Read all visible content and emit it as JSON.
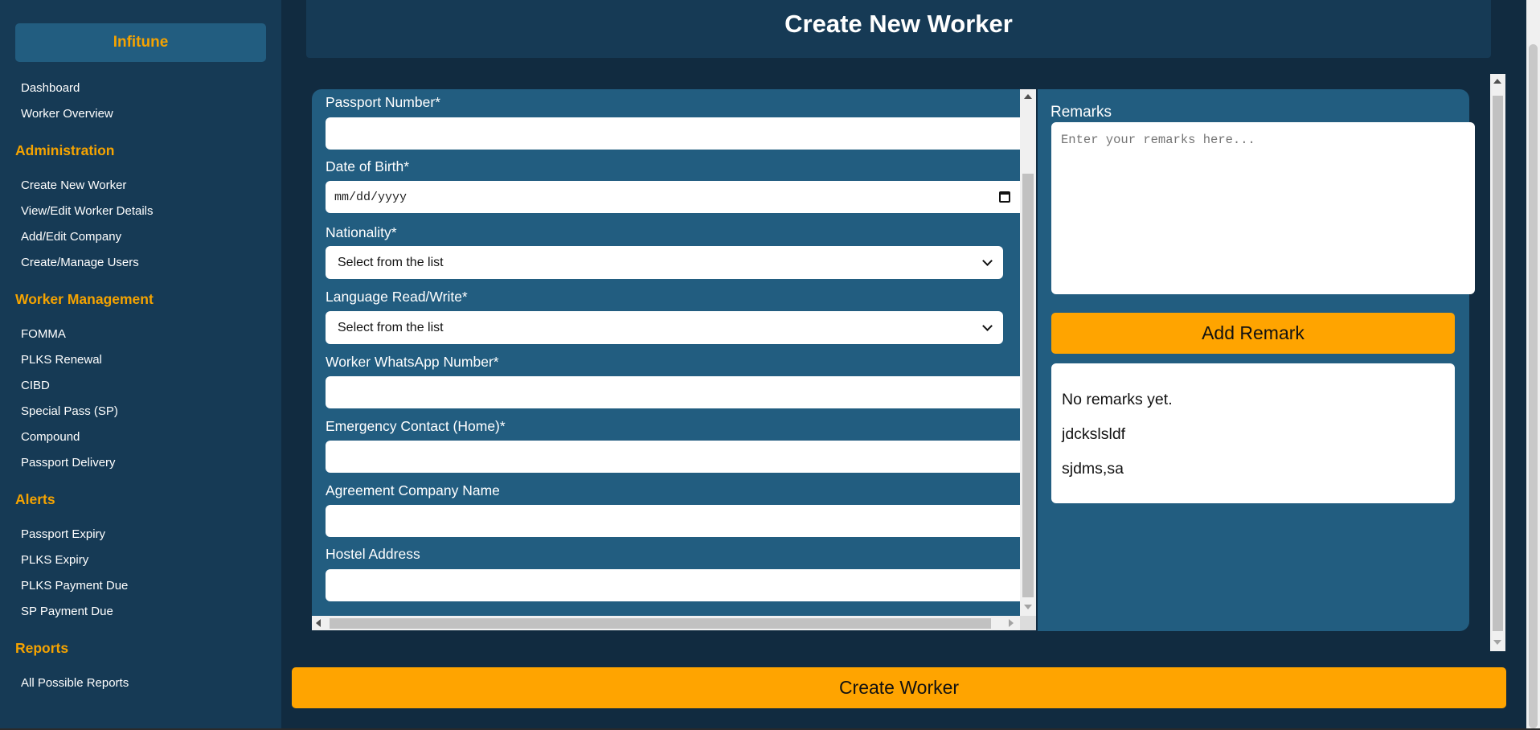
{
  "sidebar": {
    "brand": "Infitune",
    "top_links": [
      "Dashboard",
      "Worker Overview"
    ],
    "sections": [
      {
        "heading": "Administration",
        "items": [
          "Create New Worker",
          "View/Edit Worker Details",
          "Add/Edit Company",
          "Create/Manage Users"
        ]
      },
      {
        "heading": "Worker Management",
        "items": [
          "FOMMA",
          "PLKS Renewal",
          "CIBD",
          "Special Pass (SP)",
          "Compound",
          "Passport Delivery"
        ]
      },
      {
        "heading": "Alerts",
        "items": [
          "Passport Expiry",
          "PLKS Expiry",
          "PLKS Payment Due",
          "SP Payment Due"
        ]
      },
      {
        "heading": "Reports",
        "items": [
          "All Possible Reports"
        ]
      }
    ]
  },
  "header": {
    "title": "Create New Worker"
  },
  "form": {
    "passport_label": "Passport Number*",
    "passport_value": "",
    "dob_label": "Date of Birth*",
    "dob_placeholder": "mm/dd/yyyy",
    "nationality_label": "Nationality*",
    "nationality_value": "Select from the list",
    "language_label": "Language Read/Write*",
    "language_value": "Select from the list",
    "whatsapp_label": "Worker WhatsApp Number*",
    "whatsapp_value": "",
    "emergency_label": "Emergency Contact (Home)*",
    "emergency_value": "",
    "agreement_label": "Agreement Company Name",
    "agreement_value": "",
    "hostel_label": "Hostel Address",
    "hostel_value": ""
  },
  "remarks": {
    "label": "Remarks",
    "placeholder": "Enter your remarks here...",
    "add_button": "Add Remark",
    "items": [
      "No remarks yet.",
      "jdckslsldf",
      "sjdms,sa"
    ]
  },
  "actions": {
    "create_button": "Create Worker"
  },
  "colors": {
    "accent": "#ffa400",
    "sidebar_bg": "#163a55",
    "panel_bg": "#225d80",
    "page_bg": "#112b40",
    "heading": "#f5a300"
  },
  "icons": {
    "date": "calendar-icon",
    "select": "chevron-down-icon"
  }
}
